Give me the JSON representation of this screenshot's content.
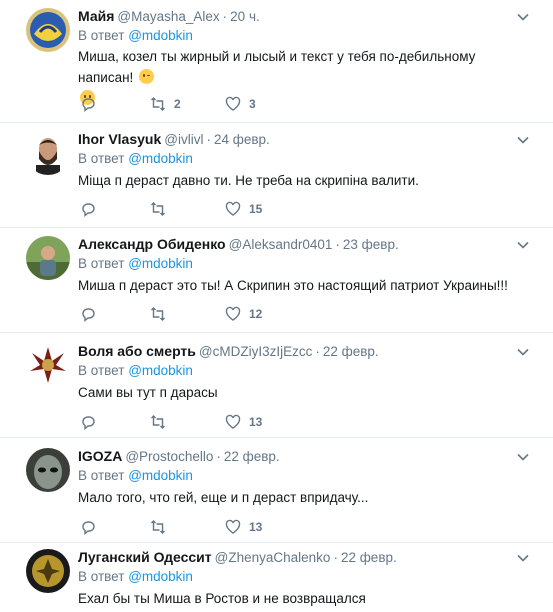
{
  "icons": {
    "reply": "reply-icon",
    "retweet": "retweet-icon",
    "like": "heart-icon",
    "more": "chevron-down-icon"
  },
  "colors": {
    "link": "#1b95e0",
    "muted": "#657786",
    "text": "#14171a",
    "divider": "#e6ecf0"
  },
  "reply_prefix": "В ответ",
  "tweets": [
    {
      "name": "Майя",
      "handle": "@Mayasha_Alex",
      "time": "20 ч.",
      "reply_to": "@mdobkin",
      "text_line1": "Миша, козел ты жирный и лысый и текст у тебя по-дебильному написан!",
      "retweets": "2",
      "likes": "3"
    },
    {
      "name": "Ihor Vlasyuk",
      "handle": "@ivlivl",
      "time": "24 февр.",
      "reply_to": "@mdobkin",
      "text": "Міща п дераст давно ти. Не треба на скрипіна валити.",
      "retweets": "",
      "likes": "15"
    },
    {
      "name": "Александр Обиденко",
      "handle": "@Aleksandr0401",
      "time": "23 февр.",
      "reply_to": "@mdobkin",
      "text": "Миша п дераст это ты! А Скрипин это настоящий патриот Украины!!!",
      "retweets": "",
      "likes": "12"
    },
    {
      "name": "Воля або смерть",
      "handle": "@cMDZiyI3zIjEzcc",
      "time": "22 февр.",
      "reply_to": "@mdobkin",
      "text": "Сами вы тут п дарасы",
      "retweets": "",
      "likes": "13"
    },
    {
      "name": "IGOZA",
      "handle": "@Prostochello",
      "time": "22 февр.",
      "reply_to": "@mdobkin",
      "text": "Мало того, что гей, еще и п дераст впридачу...",
      "retweets": "",
      "likes": "13"
    },
    {
      "name": "Луганский Одессит",
      "handle": "@ZhenyaChalenko",
      "time": "22 февр.",
      "reply_to": "@mdobkin",
      "text": "Ехал бы ты Миша в Ростов и не возвращался",
      "retweets": "",
      "likes": ""
    }
  ]
}
